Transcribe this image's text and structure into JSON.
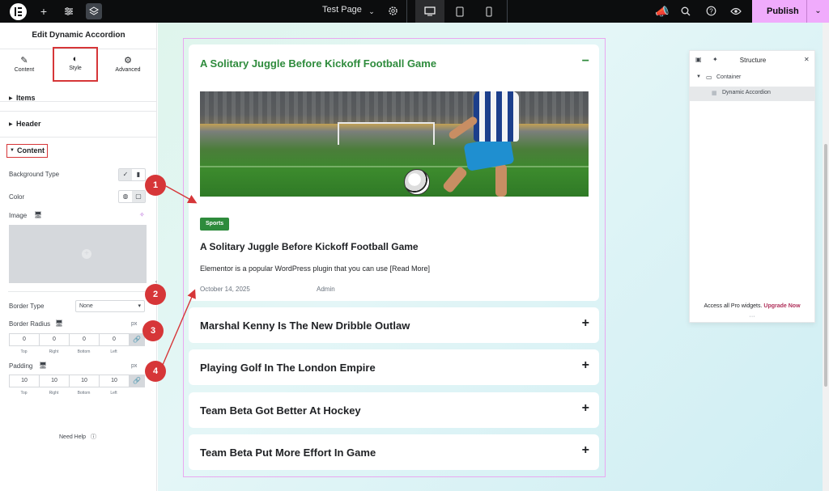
{
  "topbar": {
    "page_name": "Test Page",
    "publish_label": "Publish",
    "colors": {
      "bar": "#0c0d0e",
      "publish": "#f0abfc"
    }
  },
  "panel": {
    "title": "Edit Dynamic Accordion",
    "tabs": [
      {
        "label": "Content",
        "icon": "pencil-icon"
      },
      {
        "label": "Style",
        "icon": "half-circle-icon"
      },
      {
        "label": "Advanced",
        "icon": "gear-icon"
      }
    ],
    "sections": {
      "items": "Items",
      "header": "Header",
      "content": "Content"
    },
    "background_type_label": "Background Type",
    "color_label": "Color",
    "image_label": "Image",
    "border_type_label": "Border Type",
    "border_type_value": "None",
    "border_radius_label": "Border Radius",
    "border_radius_unit": "px",
    "border_radius": [
      "0",
      "0",
      "0",
      "0"
    ],
    "padding_label": "Padding",
    "padding_unit": "px",
    "padding": [
      "10",
      "10",
      "10",
      "10"
    ],
    "dim_labels": [
      "Top",
      "Right",
      "Bottom",
      "Left"
    ],
    "need_help": "Need Help"
  },
  "accordion": {
    "items": [
      {
        "title": "A Solitary Juggle Before Kickoff Football Game",
        "open": true,
        "toggle": "−"
      },
      {
        "title": "Marshal Kenny Is The New Dribble Outlaw",
        "open": false,
        "toggle": "+"
      },
      {
        "title": "Playing Golf In The London Empire",
        "open": false,
        "toggle": "+"
      },
      {
        "title": "Team Beta Got Better At Hockey",
        "open": false,
        "toggle": "+"
      },
      {
        "title": "Team Beta Put More Effort In Game",
        "open": false,
        "toggle": "+"
      }
    ],
    "open_content": {
      "badge": "Sports",
      "post_title": "A Solitary Juggle Before Kickoff Football Game",
      "excerpt": "Elementor is a popular WordPress plugin that you can use [Read More]",
      "date": "October 14, 2025",
      "author": "Admin"
    },
    "colors": {
      "accent": "#2e8b3c",
      "widget_outline": "#e9a8f0"
    }
  },
  "markers": [
    "1",
    "2",
    "3",
    "4"
  ],
  "structure": {
    "title": "Structure",
    "rows": [
      "Container",
      "Dynamic Accordion"
    ],
    "footer_text": "Access all Pro widgets.",
    "footer_link": "Upgrade Now",
    "dots": "···"
  }
}
